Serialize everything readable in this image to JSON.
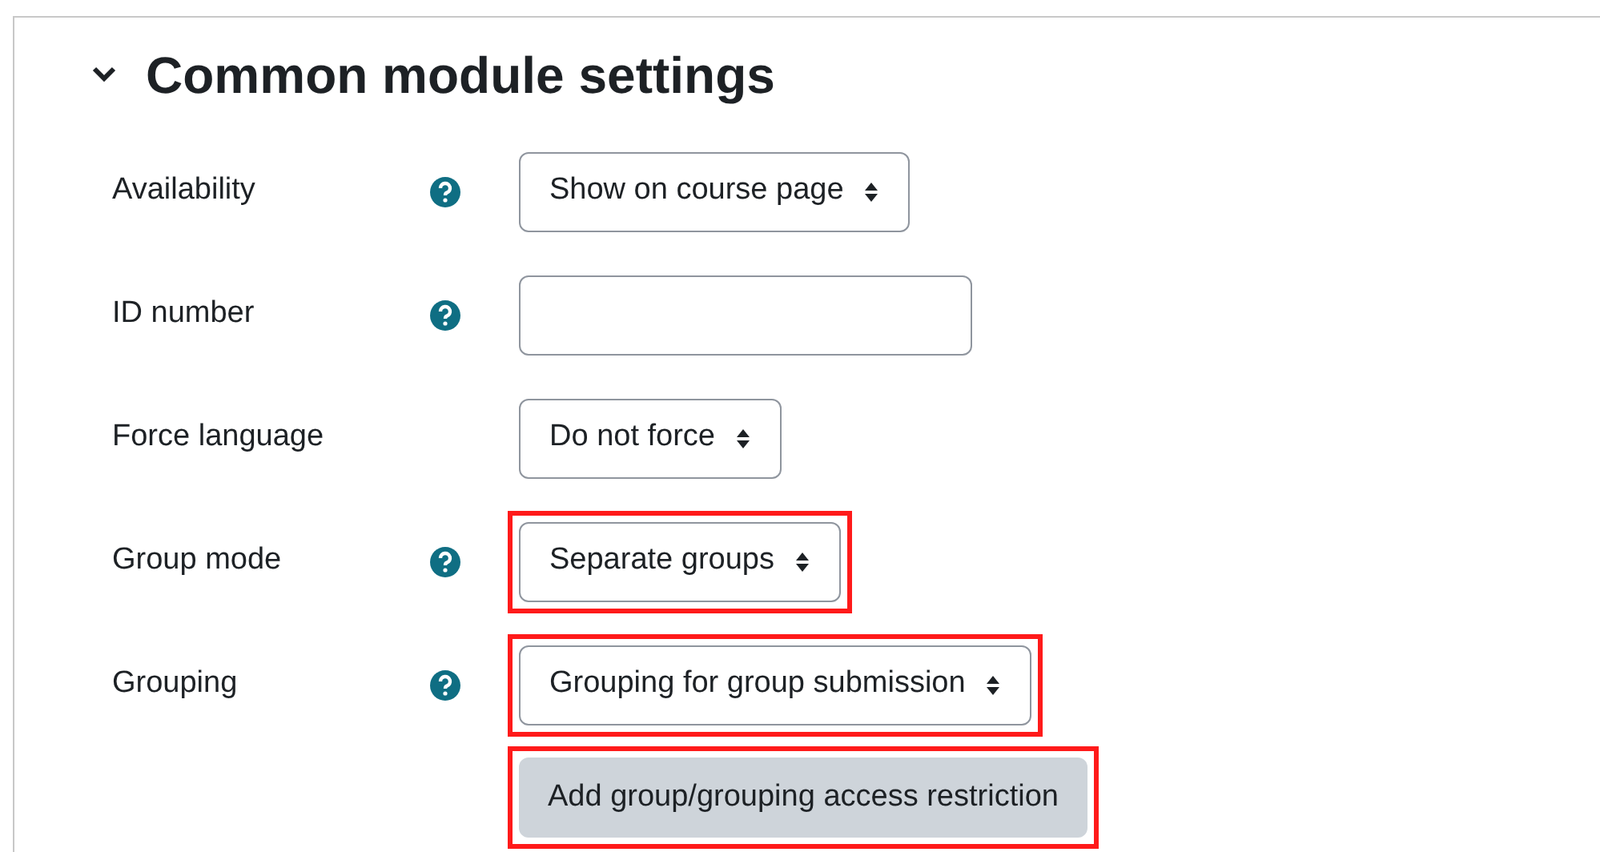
{
  "section": {
    "title": "Common module settings",
    "expanded": true
  },
  "rows": [
    {
      "label": "Availability",
      "help": true,
      "kind": "select",
      "value": "Show on course page",
      "highlighted": false
    },
    {
      "label": "ID number",
      "help": true,
      "kind": "input",
      "value": "",
      "highlighted": false
    },
    {
      "label": "Force language",
      "help": false,
      "kind": "select",
      "value": "Do not force",
      "highlighted": false
    },
    {
      "label": "Group mode",
      "help": true,
      "kind": "select",
      "value": "Separate groups",
      "highlighted": true
    },
    {
      "label": "Grouping",
      "help": true,
      "kind": "select",
      "value": "Grouping for group submission",
      "highlighted": true
    },
    {
      "kind": "button",
      "value": "Add group/grouping access restriction",
      "highlighted": true
    }
  ]
}
